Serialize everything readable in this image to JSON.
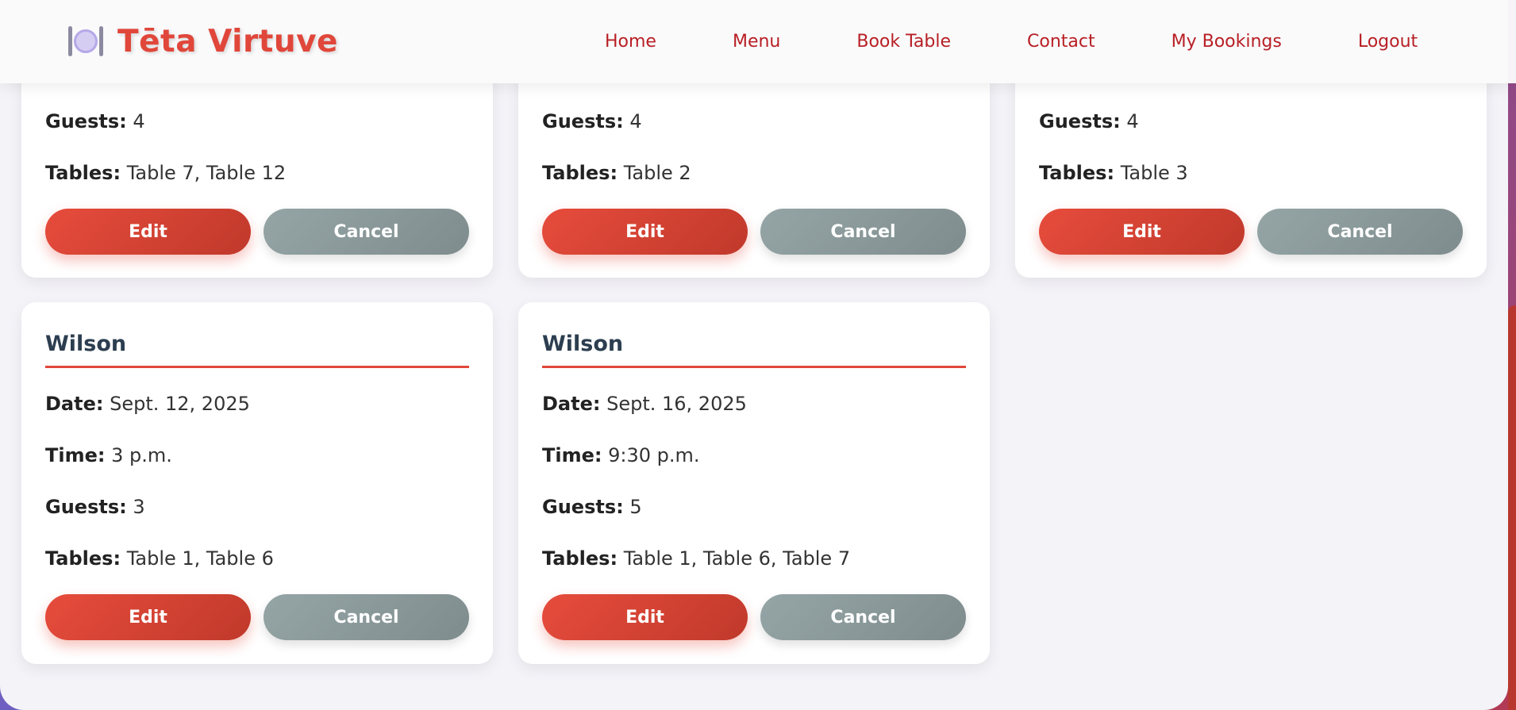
{
  "brand": {
    "name": "Tēta Virtuve",
    "icon": "plate-cutlery-icon"
  },
  "nav": {
    "items": [
      "Home",
      "Menu",
      "Book Table",
      "Contact",
      "My Bookings",
      "Logout"
    ]
  },
  "labels": {
    "date": "Date:",
    "time": "Time:",
    "guests": "Guests:",
    "tables": "Tables:",
    "edit": "Edit",
    "cancel": "Cancel"
  },
  "bookings_top": [
    {
      "guests": "4",
      "tables": "Table 7, Table 12"
    },
    {
      "guests": "4",
      "tables": "Table 2"
    },
    {
      "guests": "4",
      "tables": "Table 3"
    }
  ],
  "bookings_bottom": [
    {
      "name": "Wilson",
      "date": "Sept. 12, 2025",
      "time": "3 p.m.",
      "guests": "3",
      "tables": "Table 1, Table 6"
    },
    {
      "name": "Wilson",
      "date": "Sept. 16, 2025",
      "time": "9:30 p.m.",
      "guests": "5",
      "tables": "Table 1, Table 6, Table 7"
    }
  ],
  "colors": {
    "accent": "#e0473a",
    "nav_link": "#b81f24",
    "edit_button": "#e74c3c",
    "cancel_button": "#95a5a6",
    "heading": "#2c3e50"
  }
}
